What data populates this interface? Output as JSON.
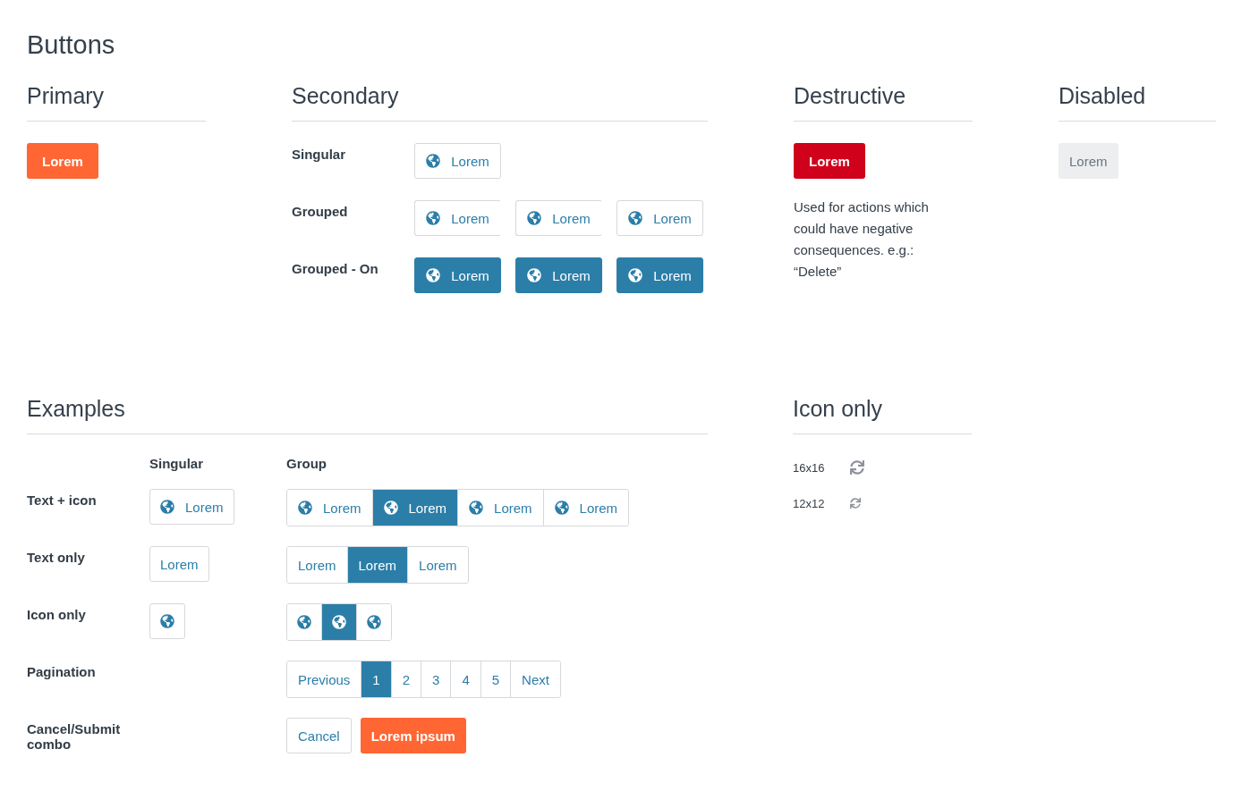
{
  "title": "Buttons",
  "primary": {
    "heading": "Primary",
    "button": "Lorem"
  },
  "secondary": {
    "heading": "Secondary",
    "rows": [
      {
        "label": "Singular",
        "kind": "singular",
        "buttons": [
          {
            "label": "Lorem",
            "selected": false
          }
        ]
      },
      {
        "label": "Grouped",
        "kind": "grouped",
        "buttons": [
          {
            "label": "Lorem",
            "selected": false
          },
          {
            "label": "Lorem",
            "selected": false
          },
          {
            "label": "Lorem",
            "selected": false
          }
        ]
      },
      {
        "label": "Grouped - On",
        "kind": "grouped",
        "buttons": [
          {
            "label": "Lorem",
            "selected": true
          },
          {
            "label": "Lorem",
            "selected": true
          },
          {
            "label": "Lorem",
            "selected": true
          }
        ]
      }
    ]
  },
  "destructive": {
    "heading": "Destructive",
    "button": "Lorem",
    "description": "Used for actions which could have negative consequences. e.g.: “Delete”"
  },
  "disabled": {
    "heading": "Disabled",
    "button": "Lorem",
    "disabled": true
  },
  "examples": {
    "heading": "Examples",
    "columns": [
      "Singular",
      "Group"
    ],
    "rows": [
      {
        "label": "Text + icon",
        "kind": "text_icon",
        "singular": {
          "label": "Lorem",
          "selected": false
        },
        "group": [
          {
            "label": "Lorem",
            "selected": false
          },
          {
            "label": "Lorem",
            "selected": true
          },
          {
            "label": "Lorem",
            "selected": false
          },
          {
            "label": "Lorem",
            "selected": false
          }
        ]
      },
      {
        "label": "Text only",
        "kind": "text",
        "singular": {
          "label": "Lorem",
          "selected": false
        },
        "group": [
          {
            "label": "Lorem",
            "selected": false
          },
          {
            "label": "Lorem",
            "selected": true
          },
          {
            "label": "Lorem",
            "selected": false
          }
        ]
      },
      {
        "label": "Icon only",
        "kind": "icon",
        "singular": {
          "selected": false
        },
        "group": [
          {
            "selected": false
          },
          {
            "selected": true
          },
          {
            "selected": false
          }
        ]
      },
      {
        "label": "Pagination",
        "kind": "pagination",
        "group": [
          {
            "label": "Previous",
            "selected": false
          },
          {
            "label": "1",
            "selected": true
          },
          {
            "label": "2",
            "selected": false
          },
          {
            "label": "3",
            "selected": false
          },
          {
            "label": "4",
            "selected": false
          },
          {
            "label": "5",
            "selected": false
          },
          {
            "label": "Next",
            "selected": false
          }
        ]
      },
      {
        "label": "Cancel/Submit combo",
        "kind": "combo",
        "cancel": "Cancel",
        "submit": "Lorem ipsum"
      }
    ]
  },
  "icon_only": {
    "heading": "Icon only",
    "sizes": [
      {
        "label": "16x16",
        "kind": "large"
      },
      {
        "label": "12x12",
        "kind": "small"
      }
    ]
  }
}
